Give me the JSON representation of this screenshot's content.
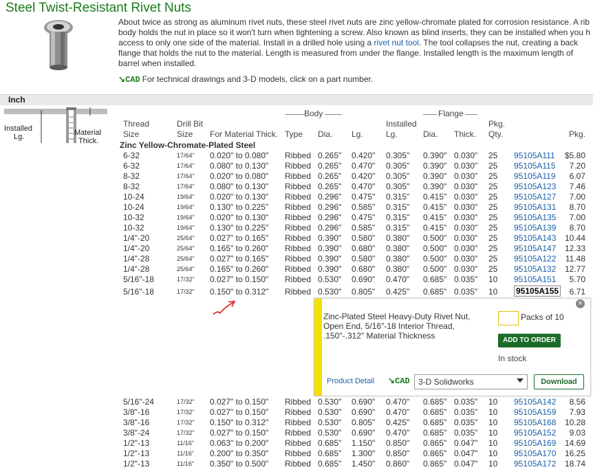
{
  "title": "Steel Twist-Resistant Rivet Nuts",
  "description": {
    "lines": [
      "About twice as strong as aluminum rivet nuts, these steel rivet nuts are zinc yellow-chromate plated for corrosion resistance. A rib",
      "body holds the nut in place so it won't turn when tightening a screw. Also known as blind inserts, they can be installed when you h",
      "access to only one side of the material. Install in a drilled hole using a ",
      ". The tool collapses the nut, creating a back",
      "flange that holds the nut to the material. Length is measured from under the flange. Installed length is the maximum length of",
      "barrel when installed."
    ],
    "link": "rivet nut tool"
  },
  "cad_line": {
    "badge": "CAD",
    "text": "For technical drawings and 3-D models, click on a part number."
  },
  "section": "Inch",
  "diagram": {
    "installed": "Installed",
    "lg": "Lg.",
    "material": "Material",
    "thick": "Thick."
  },
  "headers": {
    "body_group": "Body",
    "flange_group": "Flange",
    "thread1": "Thread",
    "thread2": "Size",
    "drill1": "Drill Bit",
    "drill2": "Size",
    "thick": "For Material Thick.",
    "type": "Type",
    "dia": "Dia.",
    "lg": "Lg.",
    "inst1": "Installed",
    "inst2": "Lg.",
    "fdia": "Dia.",
    "fthick": "Thick.",
    "pkg1": "Pkg.",
    "pkg2": "Qty.",
    "price": "Pkg."
  },
  "subhead": "Zinc Yellow-Chromate-Plated Steel",
  "rows": [
    {
      "thread": "6-32",
      "drill": "17/64\"",
      "thick": "0.020\" to 0.080\"",
      "type": "Ribbed",
      "dia": "0.265\"",
      "lg": "0.420\"",
      "inst": "0.305\"",
      "fdia": "0.390\"",
      "fthick": "0.030\"",
      "qty": "25",
      "part": "95105A111",
      "price": "$5.80"
    },
    {
      "thread": "6-32",
      "drill": "17/64\"",
      "thick": "0.080\" to 0.130\"",
      "type": "Ribbed",
      "dia": "0.265\"",
      "lg": "0.470\"",
      "inst": "0.305\"",
      "fdia": "0.390\"",
      "fthick": "0.030\"",
      "qty": "25",
      "part": "95105A115",
      "price": "7.20"
    },
    {
      "thread": "8-32",
      "drill": "17/64\"",
      "thick": "0.020\" to 0.080\"",
      "type": "Ribbed",
      "dia": "0.265\"",
      "lg": "0.420\"",
      "inst": "0.305\"",
      "fdia": "0.390\"",
      "fthick": "0.030\"",
      "qty": "25",
      "part": "95105A119",
      "price": "6.07"
    },
    {
      "thread": "8-32",
      "drill": "17/64\"",
      "thick": "0.080\" to 0.130\"",
      "type": "Ribbed",
      "dia": "0.265\"",
      "lg": "0.470\"",
      "inst": "0.305\"",
      "fdia": "0.390\"",
      "fthick": "0.030\"",
      "qty": "25",
      "part": "95105A123",
      "price": "7.46"
    },
    {
      "thread": "10-24",
      "drill": "19/64\"",
      "thick": "0.020\" to 0.130\"",
      "type": "Ribbed",
      "dia": "0.296\"",
      "lg": "0.475\"",
      "inst": "0.315\"",
      "fdia": "0.415\"",
      "fthick": "0.030\"",
      "qty": "25",
      "part": "95105A127",
      "price": "7.00"
    },
    {
      "thread": "10-24",
      "drill": "19/64\"",
      "thick": "0.130\" to 0.225\"",
      "type": "Ribbed",
      "dia": "0.296\"",
      "lg": "0.585\"",
      "inst": "0.315\"",
      "fdia": "0.415\"",
      "fthick": "0.030\"",
      "qty": "25",
      "part": "95105A131",
      "price": "8.70"
    },
    {
      "thread": "10-32",
      "drill": "19/64\"",
      "thick": "0.020\" to 0.130\"",
      "type": "Ribbed",
      "dia": "0.296\"",
      "lg": "0.475\"",
      "inst": "0.315\"",
      "fdia": "0.415\"",
      "fthick": "0.030\"",
      "qty": "25",
      "part": "95105A135",
      "price": "7.00"
    },
    {
      "thread": "10-32",
      "drill": "19/64\"",
      "thick": "0.130\" to 0.225\"",
      "type": "Ribbed",
      "dia": "0.296\"",
      "lg": "0.585\"",
      "inst": "0.315\"",
      "fdia": "0.415\"",
      "fthick": "0.030\"",
      "qty": "25",
      "part": "95105A139",
      "price": "8.70"
    },
    {
      "thread": "1/4\"-20",
      "drill": "25/64\"",
      "thick": "0.027\" to 0.165\"",
      "type": "Ribbed",
      "dia": "0.390\"",
      "lg": "0.580\"",
      "inst": "0.380\"",
      "fdia": "0.500\"",
      "fthick": "0.030\"",
      "qty": "25",
      "part": "95105A143",
      "price": "10.44"
    },
    {
      "thread": "1/4\"-20",
      "drill": "25/64\"",
      "thick": "0.165\" to 0.260\"",
      "type": "Ribbed",
      "dia": "0.390\"",
      "lg": "0.680\"",
      "inst": "0.380\"",
      "fdia": "0.500\"",
      "fthick": "0.030\"",
      "qty": "25",
      "part": "95105A147",
      "price": "12.33"
    },
    {
      "thread": "1/4\"-28",
      "drill": "25/64\"",
      "thick": "0.027\" to 0.165\"",
      "type": "Ribbed",
      "dia": "0.390\"",
      "lg": "0.580\"",
      "inst": "0.380\"",
      "fdia": "0.500\"",
      "fthick": "0.030\"",
      "qty": "25",
      "part": "95105A122",
      "price": "11.48"
    },
    {
      "thread": "1/4\"-28",
      "drill": "25/64\"",
      "thick": "0.165\" to 0.260\"",
      "type": "Ribbed",
      "dia": "0.390\"",
      "lg": "0.680\"",
      "inst": "0.380\"",
      "fdia": "0.500\"",
      "fthick": "0.030\"",
      "qty": "25",
      "part": "95105A132",
      "price": "12.77"
    },
    {
      "thread": "5/16\"-18",
      "drill": "17/32\"",
      "thick": "0.027\" to 0.150\"",
      "type": "Ribbed",
      "dia": "0.530\"",
      "lg": "0.690\"",
      "inst": "0.470\"",
      "fdia": "0.685\"",
      "fthick": "0.035\"",
      "qty": "10",
      "part": "95105A151",
      "price": "5.70"
    },
    {
      "thread": "5/16\"-18",
      "drill": "17/32\"",
      "thick": "0.150\" to 0.312\"",
      "type": "Ribbed",
      "dia": "0.530\"",
      "lg": "0.805\"",
      "inst": "0.425\"",
      "fdia": "0.685\"",
      "fthick": "0.035\"",
      "qty": "10",
      "part": "95105A155",
      "price": "6.71",
      "selected": true
    },
    {
      "thread": "5/16\"-24",
      "drill": "17/32\"",
      "thick": "0.027\" to 0.150\"",
      "type": "Ribbed",
      "dia": "0.530\"",
      "lg": "0.690\"",
      "inst": "0.470\"",
      "fdia": "0.685\"",
      "fthick": "0.035\"",
      "qty": "10",
      "part": "95105A142",
      "price": "8.56"
    },
    {
      "thread": "3/8\"-16",
      "drill": "17/32\"",
      "thick": "0.027\" to 0.150\"",
      "type": "Ribbed",
      "dia": "0.530\"",
      "lg": "0.690\"",
      "inst": "0.470\"",
      "fdia": "0.685\"",
      "fthick": "0.035\"",
      "qty": "10",
      "part": "95105A159",
      "price": "7.93"
    },
    {
      "thread": "3/8\"-16",
      "drill": "17/32\"",
      "thick": "0.150\" to 0.312\"",
      "type": "Ribbed",
      "dia": "0.530\"",
      "lg": "0.805\"",
      "inst": "0.425\"",
      "fdia": "0.685\"",
      "fthick": "0.035\"",
      "qty": "10",
      "part": "95105A168",
      "price": "10.28"
    },
    {
      "thread": "3/8\"-24",
      "drill": "17/32\"",
      "thick": "0.027\" to 0.150\"",
      "type": "Ribbed",
      "dia": "0.530\"",
      "lg": "0.690\"",
      "inst": "0.470\"",
      "fdia": "0.685\"",
      "fthick": "0.035\"",
      "qty": "10",
      "part": "95105A152",
      "price": "9.03"
    },
    {
      "thread": "1/2\"-13",
      "drill": "11/16\"",
      "thick": "0.063\" to 0.200\"",
      "type": "Ribbed",
      "dia": "0.685\"",
      "lg": "1.150\"",
      "inst": "0.850\"",
      "fdia": "0.865\"",
      "fthick": "0.047\"",
      "qty": "10",
      "part": "95105A169",
      "price": "14.69"
    },
    {
      "thread": "1/2\"-13",
      "drill": "11/16\"",
      "thick": "0.200\" to 0.350\"",
      "type": "Ribbed",
      "dia": "0.685\"",
      "lg": "1.300\"",
      "inst": "0.850\"",
      "fdia": "0.865\"",
      "fthick": "0.047\"",
      "qty": "10",
      "part": "95105A170",
      "price": "16.25"
    },
    {
      "thread": "1/2\"-13",
      "drill": "11/16\"",
      "thick": "0.350\" to 0.500\"",
      "type": "Ribbed",
      "dia": "0.685\"",
      "lg": "1.450\"",
      "inst": "0.860\"",
      "fdia": "0.865\"",
      "fthick": "0.047\"",
      "qty": "10",
      "part": "95105A172",
      "price": "18.74"
    }
  ],
  "popup": {
    "description": "Zinc-Plated Steel Heavy-Duty Rivet Nut, Open End, 5/16\"-18 Interior Thread, .150\"-.312\" Material Thickness",
    "qty_value": "",
    "packs_label": "Packs of 10",
    "add_button": "ADD TO ORDER",
    "stock": "In stock",
    "product_detail": "Product Detail",
    "cad_badge": "CAD",
    "cad_format": "3-D Solidworks",
    "download": "Download",
    "close_glyph": "×"
  },
  "colors": {
    "title": "#1a7a1a",
    "link": "#1a5fa8",
    "button": "#1d6b28",
    "popup_stripe": "#f2e000",
    "annotation": "#e02020"
  }
}
